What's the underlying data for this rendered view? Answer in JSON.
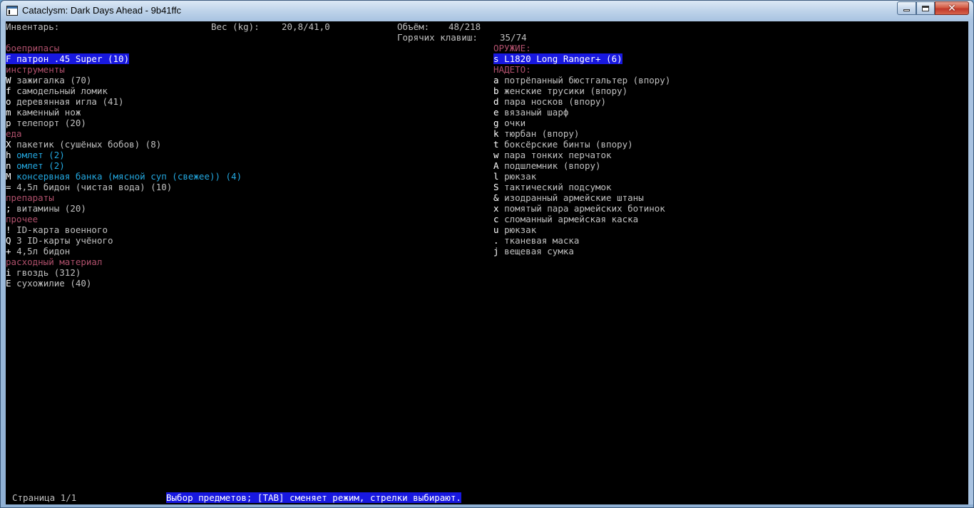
{
  "window": {
    "title": "Cataclysm: Dark Days Ahead - 9b41ffc"
  },
  "header": {
    "inventory_label": "Инвентарь:",
    "weight_label": "Вес (kg):",
    "weight_value": "20,8/41,0",
    "volume_label": "Объём:",
    "volume_value": "48/218",
    "hotkeys_label": "Горячих клавиш:",
    "hotkeys_value": "35/74"
  },
  "left_column": [
    {
      "type": "category",
      "text": "боеприпасы"
    },
    {
      "type": "item",
      "key": "F",
      "name": "патрон .45 Super (10)",
      "selected": true
    },
    {
      "type": "category",
      "text": "инструменты"
    },
    {
      "type": "item",
      "key": "W",
      "name": "зажигалка (70)"
    },
    {
      "type": "item",
      "key": "f",
      "name": "самодельный ломик"
    },
    {
      "type": "item",
      "key": "o",
      "name": "деревянная игла (41)"
    },
    {
      "type": "item",
      "key": "m",
      "name": "каменный нож"
    },
    {
      "type": "item",
      "key": "p",
      "name": "телепорт (20)"
    },
    {
      "type": "category",
      "text": "еда"
    },
    {
      "type": "item",
      "key": "X",
      "name": "пакетик (сушёных бобов) (8)"
    },
    {
      "type": "item",
      "key": "h",
      "name": "омлет (2)",
      "color": "cyan"
    },
    {
      "type": "item",
      "key": "n",
      "name": "омлет (2)",
      "color": "cyan"
    },
    {
      "type": "item",
      "key": "M",
      "name": "консервная банка (мясной суп (свежее)) (4)",
      "color": "cyan"
    },
    {
      "type": "item",
      "key": "=",
      "name": "4,5л бидон (чистая вода) (10)"
    },
    {
      "type": "category",
      "text": "препараты"
    },
    {
      "type": "item",
      "key": ";",
      "name": "витамины (20)"
    },
    {
      "type": "category",
      "text": "прочее"
    },
    {
      "type": "item",
      "key": "!",
      "name": "ID-карта военного"
    },
    {
      "type": "item",
      "key": "Q",
      "name": "3 ID-карты учёного"
    },
    {
      "type": "item",
      "key": "+",
      "name": "4,5л бидон"
    },
    {
      "type": "category",
      "text": "расходный материал"
    },
    {
      "type": "item",
      "key": "i",
      "name": "гвоздь (312)"
    },
    {
      "type": "item",
      "key": "E",
      "name": "сухожилие (40)"
    }
  ],
  "right_column": [
    {
      "type": "category",
      "text": "ОРУЖИЕ:"
    },
    {
      "type": "item",
      "key": "s",
      "name": "L1820 Long Ranger+ (6)",
      "selected": true
    },
    {
      "type": "category",
      "text": "НАДЕТО:"
    },
    {
      "type": "item",
      "key": "a",
      "name": "потрёпанный бюстгальтер (впору)"
    },
    {
      "type": "item",
      "key": "b",
      "name": "женские трусики (впору)"
    },
    {
      "type": "item",
      "key": "d",
      "name": "пара носков (впору)"
    },
    {
      "type": "item",
      "key": "e",
      "name": "вязаный шарф"
    },
    {
      "type": "item",
      "key": "g",
      "name": "очки"
    },
    {
      "type": "item",
      "key": "k",
      "name": "тюрбан (впору)"
    },
    {
      "type": "item",
      "key": "t",
      "name": "боксёрские бинты (впору)"
    },
    {
      "type": "item",
      "key": "w",
      "name": "пара тонких перчаток"
    },
    {
      "type": "item",
      "key": "A",
      "name": "подшлемник (впору)"
    },
    {
      "type": "item",
      "key": "l",
      "name": "рюкзак"
    },
    {
      "type": "item",
      "key": "S",
      "name": "тактический подсумок"
    },
    {
      "type": "item",
      "key": "&",
      "name": "изодранный армейские штаны"
    },
    {
      "type": "item",
      "key": "x",
      "name": "помятый пара армейских ботинок"
    },
    {
      "type": "item",
      "key": "c",
      "name": "сломанный армейская каска"
    },
    {
      "type": "item",
      "key": "u",
      "name": "рюкзак"
    },
    {
      "type": "item",
      "key": ".",
      "name": "тканевая маска"
    },
    {
      "type": "item",
      "key": "j",
      "name": "вещевая сумка"
    }
  ],
  "footer": {
    "page_label": "Страница 1/1",
    "status_text": "Выбор предметов; [TAB] сменяет режим, стрелки выбирают."
  },
  "colors": {
    "category": "#b0506c",
    "selection": "#1818e0",
    "highlight_item": "#23a8e0"
  }
}
